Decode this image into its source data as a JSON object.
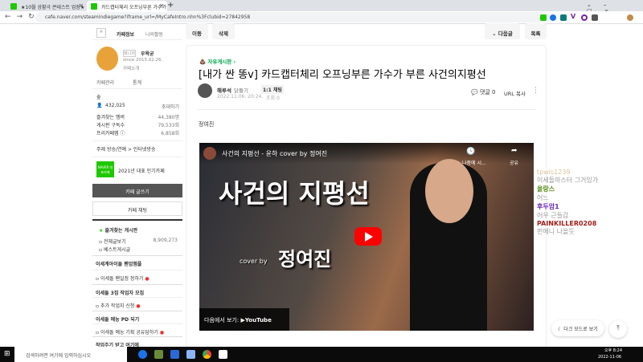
{
  "browser": {
    "tabs": [
      {
        "label": "★10월 상황극 콘테스트 업장★"
      },
      {
        "label": "카드캡터체리 오프닝부른 가수가"
      }
    ],
    "url": "cafe.naver.com/steamindiegame?iframe_url=/MyCafeIntro.nhn%3Fclubid=27842958"
  },
  "sidebar": {
    "tabs": [
      "카페정보",
      "나의활동"
    ],
    "manager_label": "매니저",
    "manager_name": "우왁굳",
    "since": "since 2015.02.26.",
    "intro": "카페소개",
    "manage": "카페관리",
    "stats": "통계",
    "level": "숲",
    "members": "432,025",
    "invite": "초대하기",
    "rows": [
      {
        "label": "즐겨찾는 멤버",
        "value": "44,380명"
      },
      {
        "label": "게시판 구독수",
        "value": "79,533회"
      },
      {
        "label": "프리카페맵 ⓘ",
        "value": "6,858회"
      }
    ],
    "topic": "주제 방송/연예 > 인터넷방송",
    "badge_text": "NAVER 대표카페",
    "badge": "2021년 대표 인기카페",
    "write": "카페 글쓰기",
    "chat": "카페 채팅",
    "fav_boards": "즐겨찾는 게시판",
    "boards": [
      {
        "label": "전체글보기",
        "value": "8,909,273"
      },
      {
        "label": "베스트게시글"
      }
    ],
    "menu": [
      {
        "label": "이세계아이돌 팬업멤플",
        "type": "header"
      },
      {
        "label": "이세돌 팬일정 정하기",
        "type": "item"
      },
      {
        "label": "이세돌 3집 작업자 모집",
        "type": "header"
      },
      {
        "label": "추가 작업자 신청",
        "type": "item"
      },
      {
        "label": "이세돌 예능 PD 되기",
        "type": "header"
      },
      {
        "label": "이세돌 예능 기획 공유담하기",
        "type": "item"
      },
      {
        "label": "작업주기 받고 여기에",
        "type": "header"
      }
    ]
  },
  "toolbar": {
    "move": "이동",
    "delete": "삭제",
    "next": "다음글",
    "list": "목록"
  },
  "post": {
    "board": "자유게시판",
    "title": "[내가 싼 똥v] 카드캡터체리 오프닝부른 가수가 부른 사건의지평선",
    "author": "해루석",
    "grade": "닭둘기",
    "chat": "1:1 채팅",
    "date": "2022.11.06. 20:24.",
    "views": "조회 0",
    "comments": "댓글 0",
    "url_copy": "URL 복사",
    "body": "정여진"
  },
  "video": {
    "title": "사건의 지평선 - 윤하 cover by 정여진",
    "watch_later": "나중에 시...",
    "share": "공유",
    "big_title": "사건의 지평선",
    "cover_by": "cover by",
    "singer": "정여진",
    "watch_on": "다음에서 보기:",
    "youtube": "YouTube"
  },
  "chat": [
    {
      "user": "tpwls1239",
      "msg": "이세돌마스터 그거잉가",
      "color": "#d8c49a"
    },
    {
      "user": "올랑스",
      "msg": "어느",
      "color": "#5a8a1a"
    },
    {
      "user": "후두암1",
      "msg": "어우 근들갑",
      "color": "#6a2ab0"
    },
    {
      "user": "PAINKILLER0208",
      "msg": "펀에니 나올듯",
      "color": "#a0201a"
    }
  ],
  "dark_mode": "다크 모드로 보기",
  "taskbar": {
    "search": "검색하려면 여기에 입력하십시오",
    "time": "오후 8:24",
    "date": "2022-11-06"
  }
}
